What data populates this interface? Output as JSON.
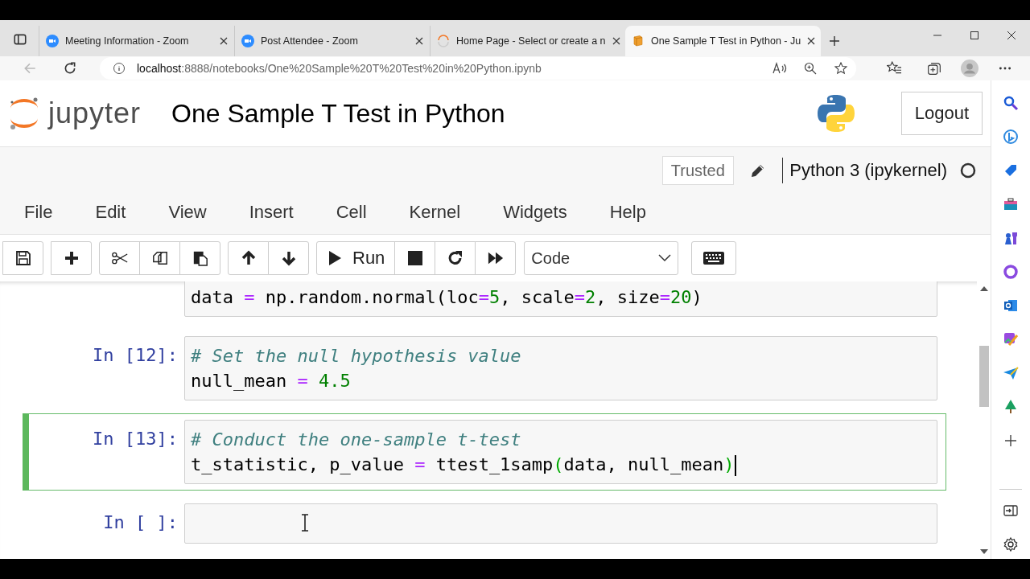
{
  "browser": {
    "tabs": [
      {
        "title": "Meeting Information - Zoom",
        "kind": "zoom",
        "selected": false
      },
      {
        "title": "Post Attendee - Zoom",
        "kind": "zoom",
        "selected": false
      },
      {
        "title": "Home Page - Select or create a n",
        "kind": "jupyter",
        "selected": false
      },
      {
        "title": "One Sample T Test in Python - Ju",
        "kind": "notebook",
        "selected": true
      }
    ],
    "address": {
      "host": "localhost",
      "path": ":8888/notebooks/One%20Sample%20T%20Test%20in%20Python.ipynb"
    }
  },
  "header": {
    "logo_text": "jupyter",
    "title": "One Sample T Test in Python",
    "logout": "Logout"
  },
  "status": {
    "trusted": "Trusted",
    "kernel": "Python 3 (ipykernel)",
    "kernel_busy": false
  },
  "menu": [
    "File",
    "Edit",
    "View",
    "Insert",
    "Cell",
    "Kernel",
    "Widgets",
    "Help"
  ],
  "toolbar": {
    "groups": [
      [
        {
          "kind": "save"
        }
      ],
      [
        {
          "kind": "add"
        }
      ],
      [
        {
          "kind": "cut"
        },
        {
          "kind": "copy"
        },
        {
          "kind": "paste"
        }
      ],
      [
        {
          "kind": "up"
        },
        {
          "kind": "down"
        }
      ],
      [
        {
          "kind": "run",
          "label": "Run"
        },
        {
          "kind": "stop"
        },
        {
          "kind": "restart"
        },
        {
          "kind": "fast-forward"
        }
      ]
    ],
    "cell_type": "Code"
  },
  "cells": [
    {
      "selected": false,
      "cursor": false,
      "lines": [
        [
          {
            "t": "data ",
            "kind": "text"
          },
          {
            "t": "=",
            "kind": "op"
          },
          {
            "t": " np.random.normal(loc",
            "kind": "text"
          },
          {
            "t": "=",
            "kind": "op"
          },
          {
            "t": "5",
            "kind": "num"
          },
          {
            "t": ", scale",
            "kind": "text"
          },
          {
            "t": "=",
            "kind": "op"
          },
          {
            "t": "2",
            "kind": "num"
          },
          {
            "t": ", size",
            "kind": "text"
          },
          {
            "t": "=",
            "kind": "op"
          },
          {
            "t": "20",
            "kind": "num"
          },
          {
            "t": ")",
            "kind": "text"
          }
        ]
      ]
    },
    {
      "prompt": "In [12]:",
      "selected": false,
      "cursor": false,
      "lines": [
        [
          {
            "t": "# Set the null hypothesis value",
            "kind": "comment"
          }
        ],
        [
          {
            "t": "null_mean ",
            "kind": "text"
          },
          {
            "t": "=",
            "kind": "op"
          },
          {
            "t": " 4.5",
            "kind": "num"
          }
        ]
      ]
    },
    {
      "prompt": "In [13]:",
      "selected": true,
      "cursor": true,
      "lines": [
        [
          {
            "t": "# Conduct the one-sample t-test",
            "kind": "comment"
          }
        ],
        [
          {
            "t": "t_statistic, p_value ",
            "kind": "text"
          },
          {
            "t": "=",
            "kind": "op"
          },
          {
            "t": " ttest_1samp",
            "kind": "text"
          },
          {
            "t": "(",
            "kind": "match"
          },
          {
            "t": "data, null_mean",
            "kind": "text"
          },
          {
            "t": ")",
            "kind": "match"
          }
        ]
      ]
    },
    {
      "prompt": "In [ ]:",
      "selected": false,
      "cursor": false
    }
  ]
}
